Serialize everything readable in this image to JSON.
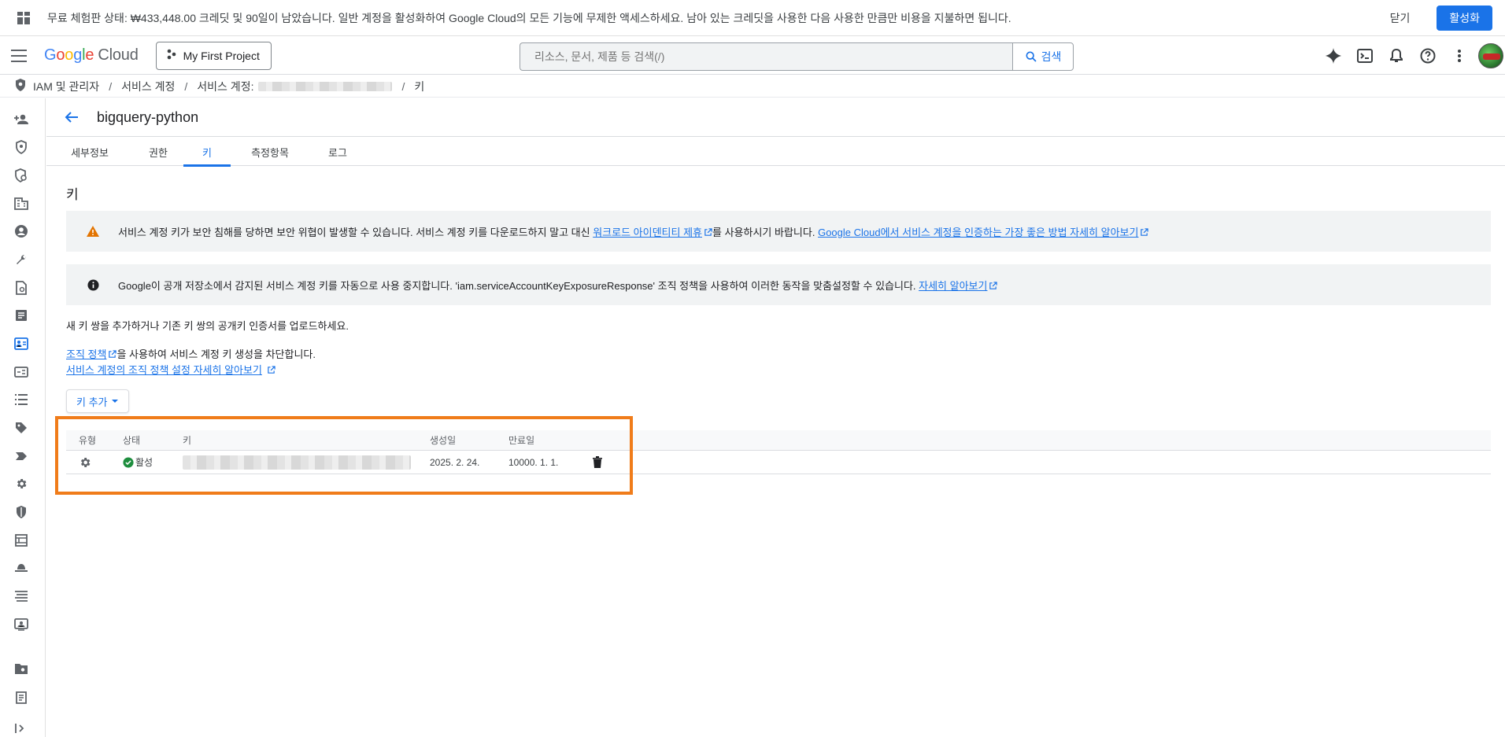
{
  "banner": {
    "text": "무료 체험판 상태: ₩433,448.00 크레딧 및 90일이 남았습니다. 일반 계정을 활성화하여 Google Cloud의 모든 기능에 무제한 액세스하세요. 남아 있는 크레딧을 사용한 다음 사용한 만큼만 비용을 지불하면 됩니다.",
    "close_label": "닫기",
    "activate_label": "활성화"
  },
  "header": {
    "logo_google": [
      "G",
      "o",
      "o",
      "g",
      "l",
      "e"
    ],
    "logo_cloud": "Cloud",
    "project_name": "My First Project",
    "search_placeholder": "리소스, 문서, 제품 등 검색(/)",
    "search_button": "검색"
  },
  "breadcrumb": {
    "root": "IAM 및 관리자",
    "service_accounts": "서비스 계정",
    "service_account_prefix": "서비스 계정:",
    "current": "키"
  },
  "page": {
    "title": "bigquery-python",
    "tabs": [
      "세부정보",
      "권한",
      "키",
      "측정항목",
      "로그"
    ],
    "active_tab": "키",
    "section_title": "키"
  },
  "alerts": {
    "warning": {
      "text_before": "서비스 계정 키가 보안 침해를 당하면 보안 위협이 발생할 수 있습니다. 서비스 계정 키를 다운로드하지 말고 대신 ",
      "link1": "워크로드 아이덴티티 제휴",
      "text_mid": "를 사용하시기 바랍니다. ",
      "link2": "Google Cloud에서 서비스 계정을 인증하는 가장 좋은 방법 자세히 알아보기"
    },
    "info": {
      "text": "Google이 공개 저장소에서 감지된 서비스 계정 키를 자동으로 사용 중지합니다. 'iam.serviceAccountKeyExposureResponse' 조직 정책을 사용하여 이러한 동작을 맞춤설정할 수 있습니다. ",
      "link": "자세히 알아보기"
    }
  },
  "body_text": {
    "add_or_upload": "새 키 쌍을 추가하거나 기존 키 쌍의 공개키 인증서를 업로드하세요.",
    "org_policy_link": "조직 정책",
    "org_policy_rest": "을 사용하여 서비스 계정 키 생성을 차단합니다.",
    "org_policy_learn": "서비스 계정의 조직 정책 설정 자세히 알아보기"
  },
  "add_key_button": "키 추가",
  "keys_table": {
    "headers": [
      "유형",
      "상태",
      "키",
      "생성일",
      "만료일"
    ],
    "rows": [
      {
        "status": "활성",
        "created": "2025. 2. 24.",
        "expires": "10000. 1. 1."
      }
    ]
  },
  "colors": {
    "accent": "#1a73e8",
    "highlight": "#f07c1a",
    "warning": "#e37400",
    "success": "#1e8e3e"
  }
}
